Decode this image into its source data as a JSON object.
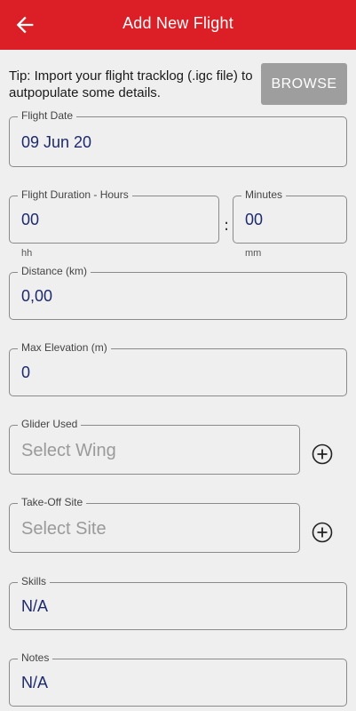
{
  "app_bar": {
    "title": "Add New Flight",
    "back_icon": "arrow-left-icon",
    "color": "#dc1f26"
  },
  "tip": {
    "text": "Tip: Import your flight tracklog (.igc file) to autpopulate some details.",
    "browse_label": "BROWSE"
  },
  "form": {
    "flight_date": {
      "label": "Flight Date",
      "value": "09 Jun 20"
    },
    "duration_hours": {
      "label": "Flight Duration - Hours",
      "value": "00",
      "hint": "hh"
    },
    "duration_separator": ":",
    "duration_minutes": {
      "label": "Minutes",
      "value": "00",
      "hint": "mm"
    },
    "distance": {
      "label": "Distance (km)",
      "value": "0,00"
    },
    "max_elevation": {
      "label": "Max Elevation (m)",
      "value": "0"
    },
    "glider": {
      "label": "Glider Used",
      "placeholder": "Select Wing",
      "add_icon": "plus-circle-icon"
    },
    "takeoff_site": {
      "label": "Take-Off Site",
      "placeholder": "Select Site",
      "add_icon": "plus-circle-icon"
    },
    "skills": {
      "label": "Skills",
      "value": "N/A"
    },
    "notes": {
      "label": "Notes",
      "value": "N/A"
    }
  }
}
